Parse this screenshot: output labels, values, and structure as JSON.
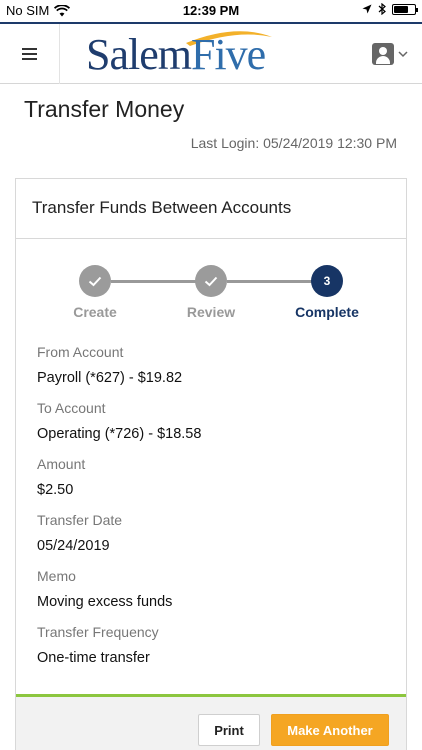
{
  "status_bar": {
    "carrier": "No SIM",
    "time": "12:39 PM"
  },
  "header": {
    "logo_part1": "Salem",
    "logo_part2": "Five",
    "icons": {
      "menu": "hamburger-menu-icon",
      "profile": "user-profile-icon"
    }
  },
  "page": {
    "title": "Transfer Money",
    "last_login": "Last Login: 05/24/2019 12:30 PM"
  },
  "card": {
    "title": "Transfer Funds Between Accounts",
    "steps": [
      {
        "label": "Create",
        "status": "complete",
        "marker": "check"
      },
      {
        "label": "Review",
        "status": "complete",
        "marker": "check"
      },
      {
        "label": "Complete",
        "status": "current",
        "marker": "3"
      }
    ],
    "fields": [
      {
        "label": "From Account",
        "value": "Payroll (*627) - $19.82"
      },
      {
        "label": "To Account",
        "value": "Operating (*726) - $18.58"
      },
      {
        "label": "Amount",
        "value": "$2.50"
      },
      {
        "label": "Transfer Date",
        "value": "05/24/2019"
      },
      {
        "label": "Memo",
        "value": "Moving excess funds"
      },
      {
        "label": "Transfer Frequency",
        "value": "One-time transfer"
      }
    ],
    "buttons": {
      "print": "Print",
      "make_another": "Make Another"
    }
  },
  "colors": {
    "brand_navy": "#173565",
    "accent_orange": "#f5a623",
    "accent_green": "#8cc63f",
    "step_done_gray": "#9b9b9b"
  }
}
